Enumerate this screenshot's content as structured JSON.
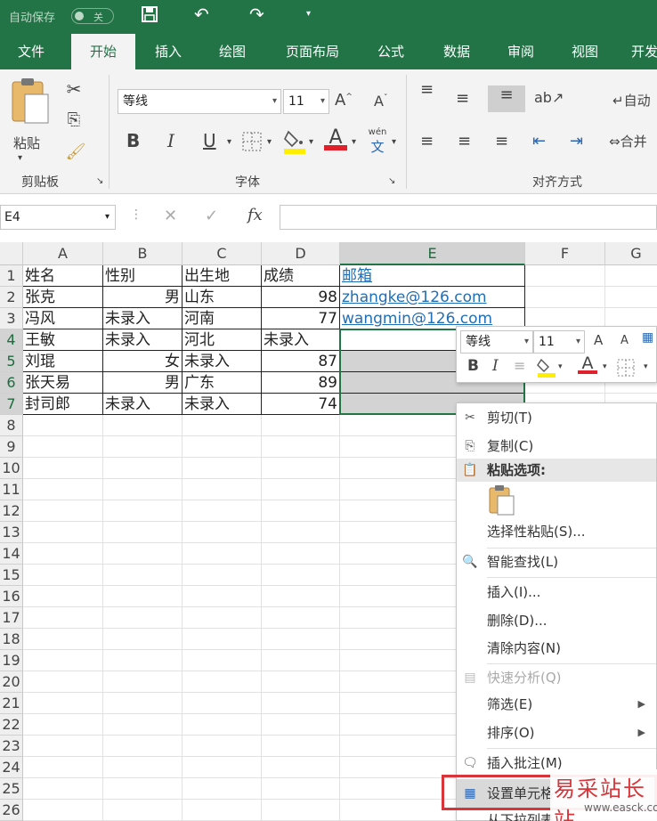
{
  "titlebar": {
    "autosave_label": "自动保存",
    "toggle_label": "关"
  },
  "tabs": [
    "文件",
    "开始",
    "插入",
    "绘图",
    "页面布局",
    "公式",
    "数据",
    "审阅",
    "视图",
    "开发"
  ],
  "ribbon": {
    "clipboard": {
      "paste_label": "粘贴",
      "group_label": "剪贴板"
    },
    "font": {
      "font_name": "等线",
      "font_size": "11",
      "group_label": "字体",
      "bold": "B",
      "italic": "I",
      "underline": "U",
      "font_color_glyph": "A",
      "phonetic_glyph": "文",
      "phonetic_top": "wén",
      "grow_glyph": "A",
      "shrink_glyph": "A"
    },
    "alignment": {
      "group_label": "对齐方式",
      "wrap_label": "自动",
      "merge_label": "合并"
    }
  },
  "formula_bar": {
    "name_box": "E4",
    "fx": "fx"
  },
  "sheet": {
    "columns": [
      "A",
      "B",
      "C",
      "D",
      "E",
      "F",
      "G"
    ],
    "rows": [
      "1",
      "2",
      "3",
      "4",
      "5",
      "6",
      "7",
      "8",
      "9",
      "10",
      "11",
      "12",
      "13",
      "14",
      "15",
      "16",
      "17",
      "18",
      "19",
      "20",
      "21",
      "22",
      "23",
      "24",
      "25",
      "26"
    ],
    "data": [
      [
        "姓名",
        "性别",
        "出生地",
        "成绩",
        "邮箱"
      ],
      [
        "张克",
        "男",
        "山东",
        "98",
        "zhangke@126.com"
      ],
      [
        "冯风",
        "未录入",
        "河南",
        "77",
        "wangmin@126.com"
      ],
      [
        "王敏",
        "未录入",
        "河北",
        "未录入",
        ""
      ],
      [
        "刘琨",
        "女",
        "未录入",
        "87",
        ""
      ],
      [
        "张天易",
        "男",
        "广东",
        "89",
        ""
      ],
      [
        "封司郎",
        "未录入",
        "未录入",
        "74",
        ""
      ]
    ]
  },
  "mini_toolbar": {
    "font_name": "等线",
    "font_size": "11",
    "bold": "B",
    "italic": "I",
    "font_color_glyph": "A",
    "grow_glyph": "A",
    "shrink_glyph": "A"
  },
  "context_menu": {
    "items": [
      {
        "label": "剪切(T)",
        "icon": "scissors-icon"
      },
      {
        "label": "复制(C)",
        "icon": "copy-icon"
      },
      {
        "label": "粘贴选项:",
        "icon": "paste-icon"
      },
      {
        "label": "选择性粘贴(S)...",
        "icon": ""
      },
      {
        "label": "智能查找(L)",
        "icon": "smart-lookup-icon"
      },
      {
        "label": "插入(I)...",
        "icon": ""
      },
      {
        "label": "删除(D)...",
        "icon": ""
      },
      {
        "label": "清除内容(N)",
        "icon": ""
      },
      {
        "label": "快速分析(Q)",
        "icon": "quick-analysis-icon"
      },
      {
        "label": "筛选(E)",
        "icon": ""
      },
      {
        "label": "排序(O)",
        "icon": ""
      },
      {
        "label": "插入批注(M)",
        "icon": "comment-icon"
      },
      {
        "label": "设置单元格",
        "icon": "format-cells-icon"
      },
      {
        "label": "从下拉列表",
        "icon": ""
      }
    ]
  },
  "watermark": {
    "cn": "易采站长站",
    "url": "www.easck.com"
  },
  "colors": {
    "accent": "#227447",
    "highlight_box": "#d8343a",
    "link": "#1f6fb8"
  }
}
